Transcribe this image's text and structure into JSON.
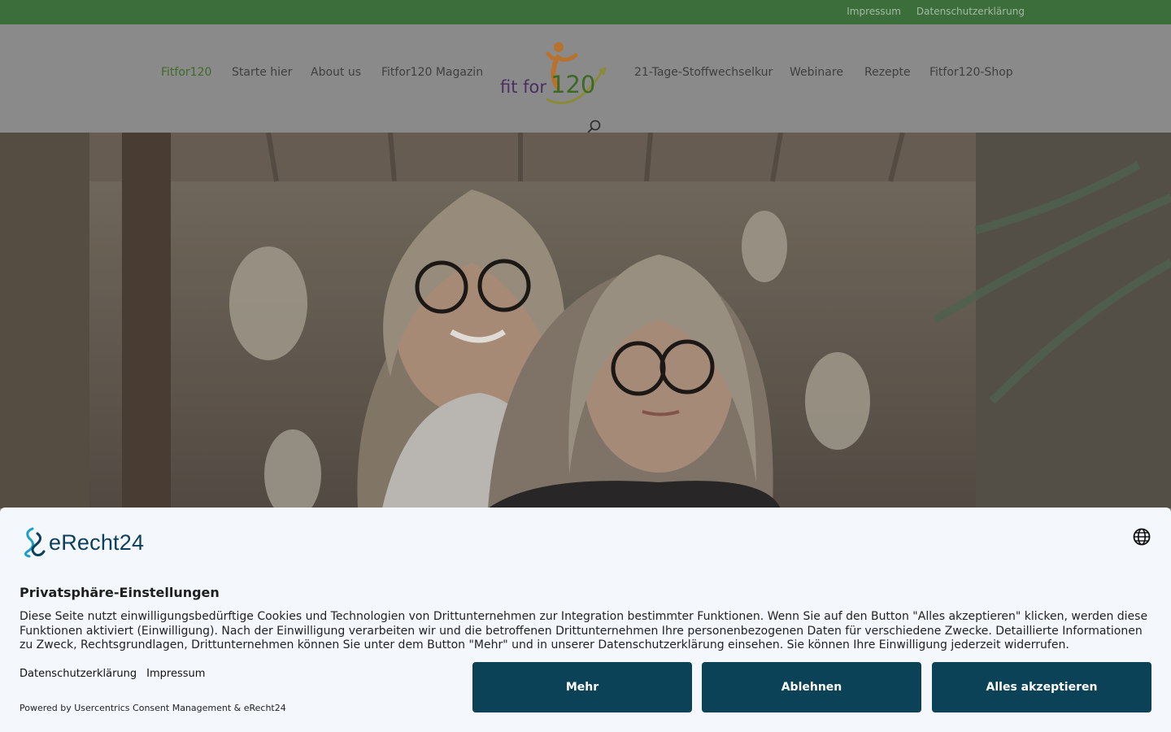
{
  "topbar": {
    "links": [
      "Impressum",
      "Datenschutzerklärung"
    ]
  },
  "nav": {
    "items": [
      "Fitfor120",
      "Starte hier",
      "About us",
      "Fitfor120 Magazin",
      "21-Tage-Stoffwechselkur",
      "Webinare",
      "Rezepte",
      "Fitfor120-Shop"
    ],
    "active_index": 0,
    "logo_text_part1": "fit for",
    "logo_text_part2": "120"
  },
  "consent": {
    "brand": "eRecht24",
    "title": "Privatsphäre-Einstellungen",
    "description": "Diese Seite nutzt einwilligungsbedürftige Cookies und Technologien von Drittunternehmen zur Integration bestimmter Funktionen. Wenn Sie auf den Button \"Alles akzeptieren\" klicken, werden diese Funktionen aktiviert (Einwilligung). Nach der Einwilligung verarbeiten wir und die betroffenen Drittunternehmen Ihre personenbezogenen Daten für verschiedene Zwecke. Detaillierte Informationen zu Zweck, Rechtsgrundlagen, Drittunternehmen können Sie unter dem Button \"Mehr\" und in unserer Datenschutzerklärung einsehen. Sie können Ihre Einwilligung jederzeit widerrufen.",
    "link_privacy": "Datenschutzerklärung",
    "link_imprint": "Impressum",
    "powered_by": "Powered by Usercentrics Consent Management & eRecht24",
    "buttons": {
      "more": "Mehr",
      "decline": "Ablehnen",
      "accept_all": "Alles akzeptieren"
    }
  },
  "colors": {
    "topbar": "#3c6e3c",
    "nav_active": "#3d6b2a",
    "button": "#0b4257",
    "panel": "#f4f7fb"
  },
  "icons": [
    "search-icon",
    "globe-icon",
    "erecht24-logo-icon"
  ]
}
